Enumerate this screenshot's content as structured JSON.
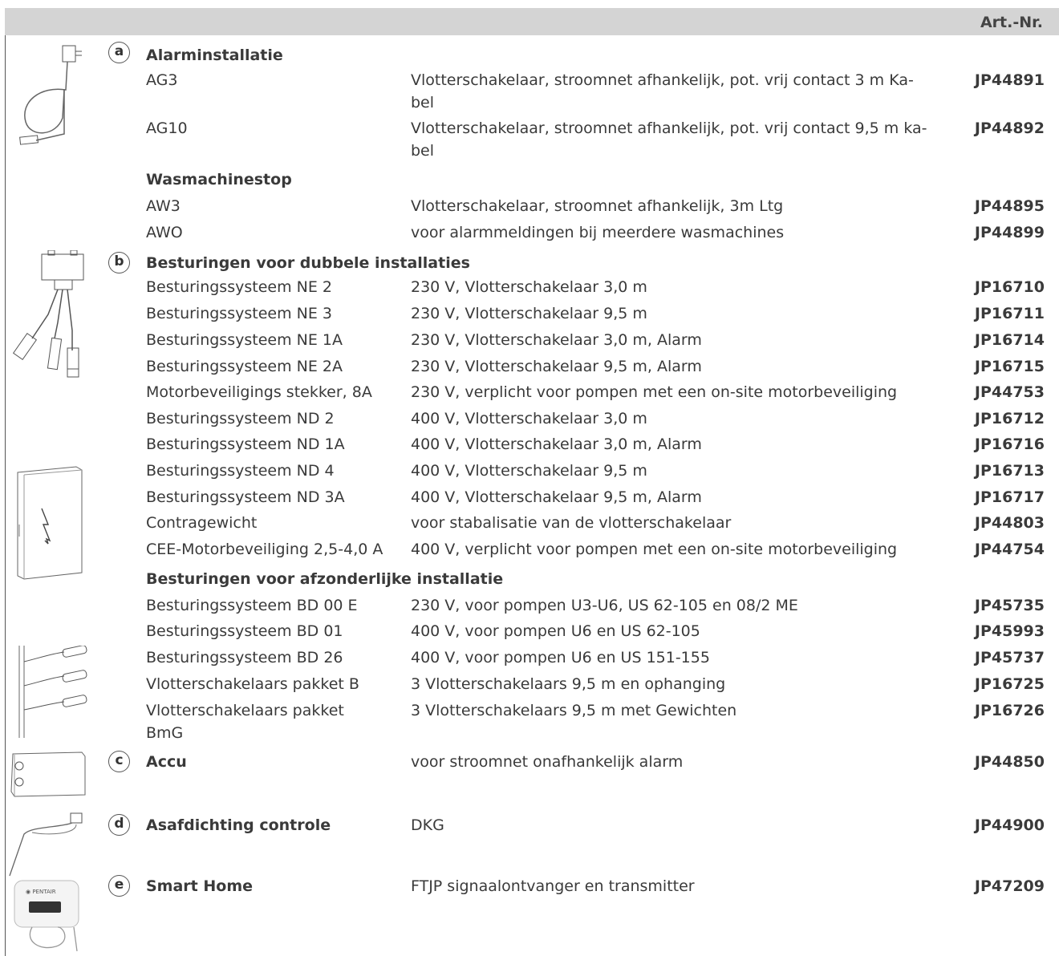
{
  "header": {
    "artnr_label": "Art.-Nr."
  },
  "section_a": {
    "letter": "a",
    "title": "Alarminstallatie",
    "rows": [
      {
        "name": "AG3",
        "desc": "Vlotterschakelaar, stroomnet afhankelijk, pot. vrij contact 3 m Ka-\nbel",
        "art": "JP44891"
      },
      {
        "name": "AG10",
        "desc": "Vlotterschakelaar, stroomnet afhankelijk, pot. vrij contact 9,5 m ka-\nbel",
        "art": "JP44892"
      }
    ],
    "subtitle": "Wasmachinestop",
    "rows2": [
      {
        "name": "AW3",
        "desc": "Vlotterschakelaar, stroomnet afhankelijk, 3m Ltg",
        "art": "JP44895"
      },
      {
        "name": "AWO",
        "desc": "voor alarmmeldingen bij meerdere wasmachines",
        "art": "JP44899"
      }
    ]
  },
  "section_b": {
    "letter": "b",
    "title": "Besturingen voor dubbele installaties",
    "rows": [
      {
        "name": "Besturingssysteem NE 2",
        "desc": "230 V, Vlotterschakelaar 3,0 m",
        "art": "JP16710"
      },
      {
        "name": "Besturingssysteem NE 3",
        "desc": "230 V, Vlotterschakelaar 9,5 m",
        "art": "JP16711"
      },
      {
        "name": "Besturingssysteem NE 1A",
        "desc": "230 V, Vlotterschakelaar 3,0 m, Alarm",
        "art": "JP16714"
      },
      {
        "name": "Besturingssysteem NE 2A",
        "desc": "230 V, Vlotterschakelaar 9,5 m, Alarm",
        "art": "JP16715"
      },
      {
        "name": "Motorbeveiligings stekker, 8A",
        "desc": "230 V, verplicht voor pompen met een on-site motorbeveiliging",
        "art": "JP44753"
      },
      {
        "name": "Besturingssysteem ND 2",
        "desc": "400 V, Vlotterschakelaar 3,0 m",
        "art": "JP16712"
      },
      {
        "name": "Besturingssysteem ND 1A",
        "desc": "400 V, Vlotterschakelaar 3,0 m, Alarm",
        "art": "JP16716"
      },
      {
        "name": "Besturingssysteem ND 4",
        "desc": "400 V, Vlotterschakelaar 9,5 m",
        "art": "JP16713"
      },
      {
        "name": "Besturingssysteem ND 3A",
        "desc": "400 V, Vlotterschakelaar 9,5 m, Alarm",
        "art": "JP16717"
      },
      {
        "name": "Contragewicht",
        "desc": "voor stabalisatie van de vlotterschakelaar",
        "art": "JP44803"
      },
      {
        "name": "CEE-Motorbeveiliging 2,5-4,0 A",
        "desc": "400 V, verplicht voor pompen met een on-site motorbeveiliging",
        "art": "JP44754"
      }
    ],
    "subtitle": "Besturingen voor afzonderlijke installatie",
    "rows2": [
      {
        "name": "Besturingssysteem BD 00 E",
        "desc": "230 V, voor pompen U3-U6, US 62-105 en 08/2 ME",
        "art": "JP45735"
      },
      {
        "name": "Besturingssysteem BD 01",
        "desc": "400 V, voor pompen U6 en US 62-105",
        "art": "JP45993"
      },
      {
        "name": "Besturingssysteem BD 26",
        "desc": "400 V, voor pompen U6 en US 151-155",
        "art": "JP45737"
      },
      {
        "name": "Vlotterschakelaars pakket B",
        "desc": "3 Vlotterschakelaars 9,5 m en ophanging",
        "art": "JP16725"
      },
      {
        "name": "Vlotterschakelaars pakket\nBmG",
        "desc": "3 Vlotterschakelaars 9,5 m met Gewichten",
        "art": "JP16726"
      }
    ]
  },
  "section_c": {
    "letter": "c",
    "title": "Accu",
    "desc": "voor stroomnet onafhankelijk alarm",
    "art": "JP44850"
  },
  "section_d": {
    "letter": "d",
    "title": "Asafdichting controle",
    "desc": "DKG",
    "art": "JP44900"
  },
  "section_e": {
    "letter": "e",
    "title": "Smart Home",
    "desc": "FTJP signaalontvanger en transmitter",
    "art": "JP47209"
  },
  "device_e_label": "◉ PENTAIR"
}
